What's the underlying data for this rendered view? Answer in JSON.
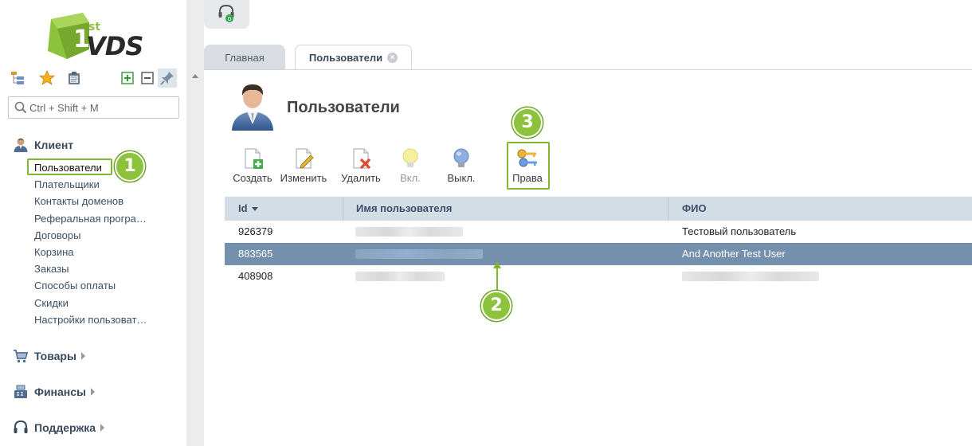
{
  "logo": {
    "sup": "st",
    "text": "VDS"
  },
  "search": {
    "placeholder": "Ctrl + Shift + M"
  },
  "sidebar": {
    "group_client": "Клиент",
    "client_items": [
      "Пользователи",
      "Плательщики",
      "Контакты доменов",
      "Реферальная програ…",
      "Договоры",
      "Корзина",
      "Заказы",
      "Способы оплаты",
      "Скидки",
      "Настройки пользоват…"
    ],
    "group_goods": "Товары",
    "group_finance": "Финансы",
    "group_support": "Поддержка"
  },
  "tabs": {
    "main": "Главная",
    "users": "Пользователи"
  },
  "page": {
    "title": "Пользователи"
  },
  "toolbar": {
    "create": "Создать",
    "edit": "Изменить",
    "delete": "Удалить",
    "enable": "Вкл.",
    "disable": "Выкл.",
    "rights": "Права"
  },
  "grid": {
    "headers": {
      "id": "Id",
      "username": "Имя пользователя",
      "fullname": "ФИО"
    },
    "rows": [
      {
        "id": "926379",
        "fullname": "Тестовый пользователь"
      },
      {
        "id": "883565",
        "fullname": "And Another Test User"
      },
      {
        "id": "408908",
        "fullname": ""
      }
    ]
  },
  "annotations": {
    "b1": "1",
    "b2": "2",
    "b3": "3"
  },
  "colors": {
    "accent_green": "#7fb830",
    "selected_row": "#7590ad",
    "header_bg": "#d3dde6"
  }
}
